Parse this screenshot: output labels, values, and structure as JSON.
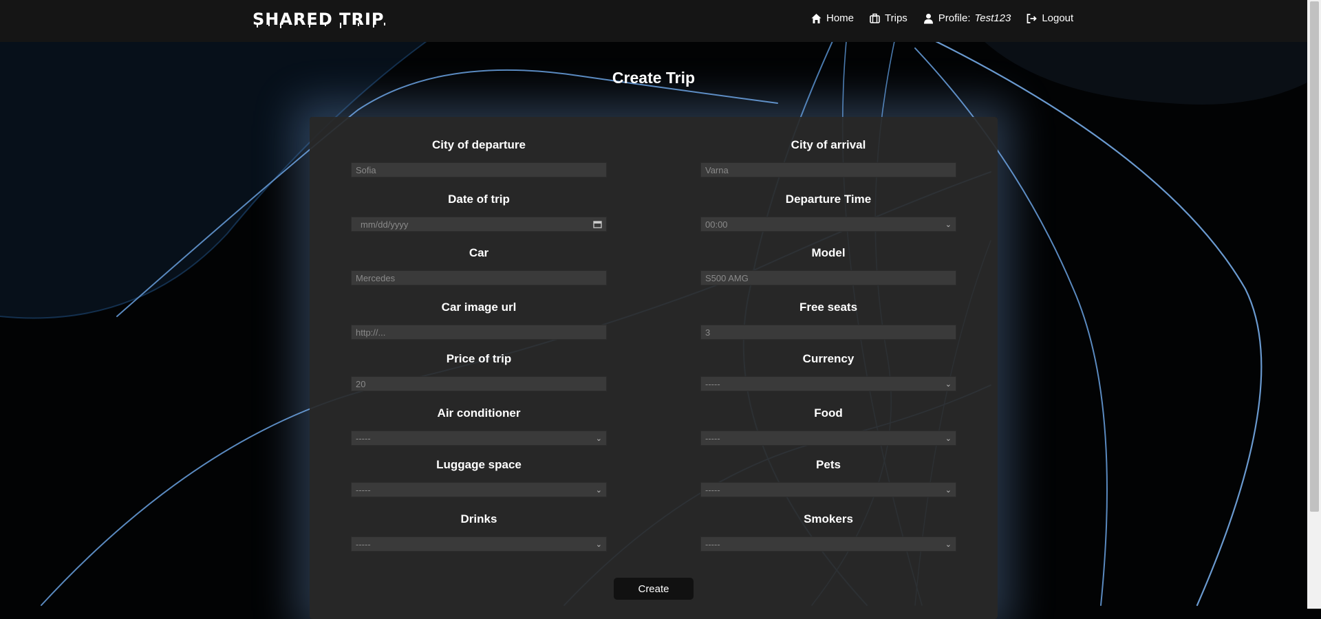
{
  "header": {
    "logo_text": "SHARED TRIP",
    "nav": [
      {
        "label": "Home",
        "icon": "home-icon"
      },
      {
        "label": "Trips",
        "icon": "suitcase-icon"
      },
      {
        "label": "Profile:",
        "icon": "user-icon",
        "username": "Test123"
      },
      {
        "label": "Logout",
        "icon": "logout-icon"
      }
    ]
  },
  "page": {
    "title": "Create Trip"
  },
  "form": {
    "fields": [
      {
        "label": "City of departure",
        "placeholder": "Sofia",
        "type": "text"
      },
      {
        "label": "City of arrival",
        "placeholder": "Varna",
        "type": "text"
      },
      {
        "label": "Date of trip",
        "placeholder": "mm/dd/yyyy",
        "type": "date"
      },
      {
        "label": "Departure Time",
        "value": "00:00",
        "type": "select"
      },
      {
        "label": "Car",
        "placeholder": "Mercedes",
        "type": "text"
      },
      {
        "label": "Model",
        "placeholder": "S500 AMG",
        "type": "text"
      },
      {
        "label": "Car image url",
        "placeholder": "http://...",
        "type": "text"
      },
      {
        "label": "Free seats",
        "placeholder": "3",
        "type": "text"
      },
      {
        "label": "Price of trip",
        "placeholder": "20",
        "type": "text"
      },
      {
        "label": "Currency",
        "value": "-----",
        "type": "select"
      },
      {
        "label": "Air conditioner",
        "value": "-----",
        "type": "select"
      },
      {
        "label": "Food",
        "value": "-----",
        "type": "select"
      },
      {
        "label": "Luggage space",
        "value": "-----",
        "type": "select"
      },
      {
        "label": "Pets",
        "value": "-----",
        "type": "select"
      },
      {
        "label": "Drinks",
        "value": "-----",
        "type": "select"
      },
      {
        "label": "Smokers",
        "value": "-----",
        "type": "select"
      }
    ],
    "submit_label": "Create"
  },
  "colors": {
    "accent_glow": "#8cbeff",
    "card_bg": "#2a2a2a",
    "navbar_bg": "#151515"
  }
}
